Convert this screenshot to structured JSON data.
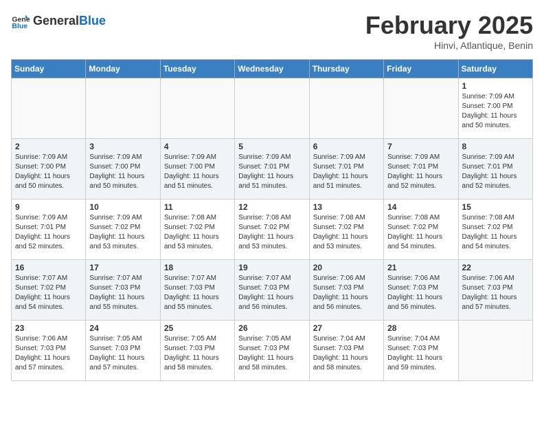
{
  "header": {
    "logo_general": "General",
    "logo_blue": "Blue",
    "title": "February 2025",
    "subtitle": "Hinvi, Atlantique, Benin"
  },
  "weekdays": [
    "Sunday",
    "Monday",
    "Tuesday",
    "Wednesday",
    "Thursday",
    "Friday",
    "Saturday"
  ],
  "weeks": [
    {
      "days": [
        {
          "date": "",
          "info": ""
        },
        {
          "date": "",
          "info": ""
        },
        {
          "date": "",
          "info": ""
        },
        {
          "date": "",
          "info": ""
        },
        {
          "date": "",
          "info": ""
        },
        {
          "date": "",
          "info": ""
        },
        {
          "date": "1",
          "info": "Sunrise: 7:09 AM\nSunset: 7:00 PM\nDaylight: 11 hours\nand 50 minutes."
        }
      ]
    },
    {
      "days": [
        {
          "date": "2",
          "info": "Sunrise: 7:09 AM\nSunset: 7:00 PM\nDaylight: 11 hours\nand 50 minutes."
        },
        {
          "date": "3",
          "info": "Sunrise: 7:09 AM\nSunset: 7:00 PM\nDaylight: 11 hours\nand 50 minutes."
        },
        {
          "date": "4",
          "info": "Sunrise: 7:09 AM\nSunset: 7:00 PM\nDaylight: 11 hours\nand 51 minutes."
        },
        {
          "date": "5",
          "info": "Sunrise: 7:09 AM\nSunset: 7:01 PM\nDaylight: 11 hours\nand 51 minutes."
        },
        {
          "date": "6",
          "info": "Sunrise: 7:09 AM\nSunset: 7:01 PM\nDaylight: 11 hours\nand 51 minutes."
        },
        {
          "date": "7",
          "info": "Sunrise: 7:09 AM\nSunset: 7:01 PM\nDaylight: 11 hours\nand 52 minutes."
        },
        {
          "date": "8",
          "info": "Sunrise: 7:09 AM\nSunset: 7:01 PM\nDaylight: 11 hours\nand 52 minutes."
        }
      ]
    },
    {
      "days": [
        {
          "date": "9",
          "info": "Sunrise: 7:09 AM\nSunset: 7:01 PM\nDaylight: 11 hours\nand 52 minutes."
        },
        {
          "date": "10",
          "info": "Sunrise: 7:09 AM\nSunset: 7:02 PM\nDaylight: 11 hours\nand 53 minutes."
        },
        {
          "date": "11",
          "info": "Sunrise: 7:08 AM\nSunset: 7:02 PM\nDaylight: 11 hours\nand 53 minutes."
        },
        {
          "date": "12",
          "info": "Sunrise: 7:08 AM\nSunset: 7:02 PM\nDaylight: 11 hours\nand 53 minutes."
        },
        {
          "date": "13",
          "info": "Sunrise: 7:08 AM\nSunset: 7:02 PM\nDaylight: 11 hours\nand 53 minutes."
        },
        {
          "date": "14",
          "info": "Sunrise: 7:08 AM\nSunset: 7:02 PM\nDaylight: 11 hours\nand 54 minutes."
        },
        {
          "date": "15",
          "info": "Sunrise: 7:08 AM\nSunset: 7:02 PM\nDaylight: 11 hours\nand 54 minutes."
        }
      ]
    },
    {
      "days": [
        {
          "date": "16",
          "info": "Sunrise: 7:07 AM\nSunset: 7:02 PM\nDaylight: 11 hours\nand 54 minutes."
        },
        {
          "date": "17",
          "info": "Sunrise: 7:07 AM\nSunset: 7:03 PM\nDaylight: 11 hours\nand 55 minutes."
        },
        {
          "date": "18",
          "info": "Sunrise: 7:07 AM\nSunset: 7:03 PM\nDaylight: 11 hours\nand 55 minutes."
        },
        {
          "date": "19",
          "info": "Sunrise: 7:07 AM\nSunset: 7:03 PM\nDaylight: 11 hours\nand 56 minutes."
        },
        {
          "date": "20",
          "info": "Sunrise: 7:06 AM\nSunset: 7:03 PM\nDaylight: 11 hours\nand 56 minutes."
        },
        {
          "date": "21",
          "info": "Sunrise: 7:06 AM\nSunset: 7:03 PM\nDaylight: 11 hours\nand 56 minutes."
        },
        {
          "date": "22",
          "info": "Sunrise: 7:06 AM\nSunset: 7:03 PM\nDaylight: 11 hours\nand 57 minutes."
        }
      ]
    },
    {
      "days": [
        {
          "date": "23",
          "info": "Sunrise: 7:06 AM\nSunset: 7:03 PM\nDaylight: 11 hours\nand 57 minutes."
        },
        {
          "date": "24",
          "info": "Sunrise: 7:05 AM\nSunset: 7:03 PM\nDaylight: 11 hours\nand 57 minutes."
        },
        {
          "date": "25",
          "info": "Sunrise: 7:05 AM\nSunset: 7:03 PM\nDaylight: 11 hours\nand 58 minutes."
        },
        {
          "date": "26",
          "info": "Sunrise: 7:05 AM\nSunset: 7:03 PM\nDaylight: 11 hours\nand 58 minutes."
        },
        {
          "date": "27",
          "info": "Sunrise: 7:04 AM\nSunset: 7:03 PM\nDaylight: 11 hours\nand 58 minutes."
        },
        {
          "date": "28",
          "info": "Sunrise: 7:04 AM\nSunset: 7:03 PM\nDaylight: 11 hours\nand 59 minutes."
        },
        {
          "date": "",
          "info": ""
        }
      ]
    }
  ]
}
